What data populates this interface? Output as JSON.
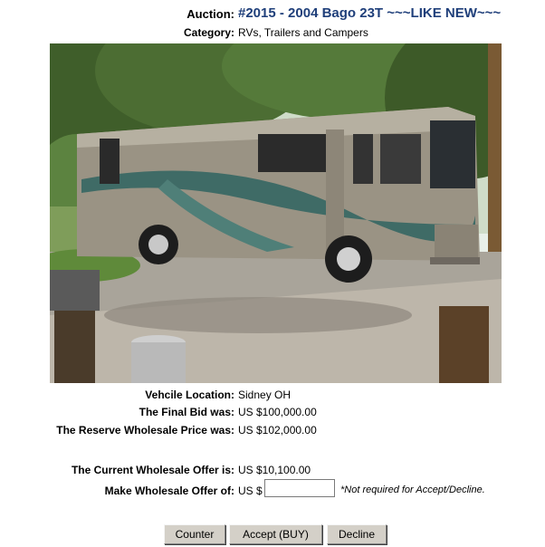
{
  "auction": {
    "label": "Auction:",
    "title": "#2015 - 2004 Bago 23T ~~~LIKE NEW~~~"
  },
  "category": {
    "label": "Category:",
    "value": "RVs, Trailers and Campers"
  },
  "details": {
    "location_label": "Vehcile Location:",
    "location_value": "Sidney OH",
    "final_bid_label": "The Final Bid was:",
    "final_bid_value": "US $100,000.00",
    "reserve_label": "The Reserve Wholesale Price was:",
    "reserve_value": "US $102,000.00",
    "current_offer_label": "The Current Wholesale Offer is:",
    "current_offer_value": "US $10,100.00",
    "make_offer_label": "Make Wholesale Offer of:",
    "make_offer_prefix": "US $",
    "make_offer_value": "",
    "make_offer_note": "*Not required for Accept/Decline."
  },
  "buttons": {
    "counter": "Counter",
    "accept": "Accept (BUY)",
    "decline": "Decline"
  },
  "colors": {
    "title_blue": "#1f3f7a",
    "button_face": "#d4d0c8"
  }
}
